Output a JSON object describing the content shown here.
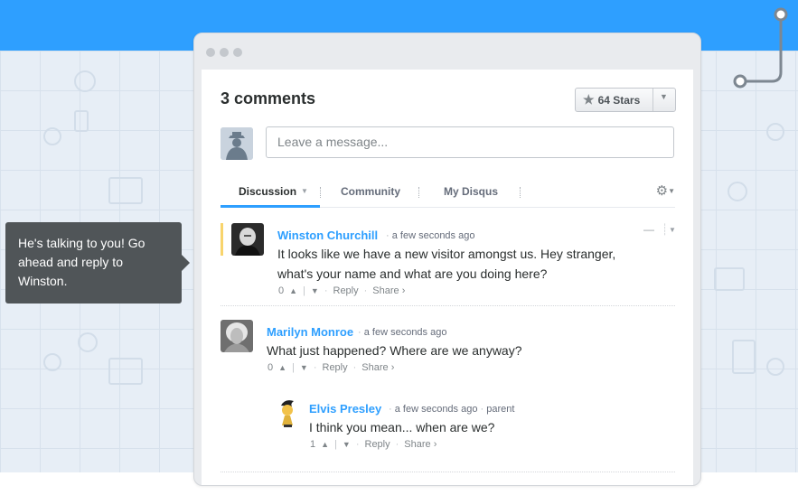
{
  "thread": {
    "comment_count": "3 comments",
    "stars_label": "64 Stars",
    "message_placeholder": "Leave a message..."
  },
  "tabs": [
    {
      "label": "Discussion",
      "active": true
    },
    {
      "label": "Community",
      "active": false
    },
    {
      "label": "My Disqus",
      "active": false
    }
  ],
  "comments": [
    {
      "author": "Winston Churchill",
      "time": "a few seconds ago",
      "parent": "",
      "text_line1": "It looks like we have a new visitor amongst us. Hey stranger,",
      "text_line2": "what's your name and what are you doing here?",
      "votes": "0",
      "reply": "Reply",
      "share": "Share ›"
    },
    {
      "author": "Marilyn Monroe",
      "time": "a few seconds ago",
      "parent": "",
      "text_line1": "What just happened? Where are we anyway?",
      "votes": "0",
      "reply": "Reply",
      "share": "Share ›"
    },
    {
      "author": "Elvis Presley",
      "time": "a few seconds ago",
      "parent": "parent",
      "text_line1": "I think you mean... when are we?",
      "votes": "1",
      "reply": "Reply",
      "share": "Share ›"
    }
  ],
  "tooltip": {
    "text": "He's talking to you! Go ahead and reply to Winston."
  },
  "icons": {
    "star": "star-icon",
    "gear": "gear-icon",
    "vote_up": "chevron-up-icon",
    "vote_down": "chevron-down-icon",
    "collapse": "minus-icon",
    "menu": "caret-down-icon"
  },
  "colors": {
    "brand_blue": "#2e9fff",
    "highlight": "#f8d46c",
    "tooltip_bg": "#505558"
  }
}
